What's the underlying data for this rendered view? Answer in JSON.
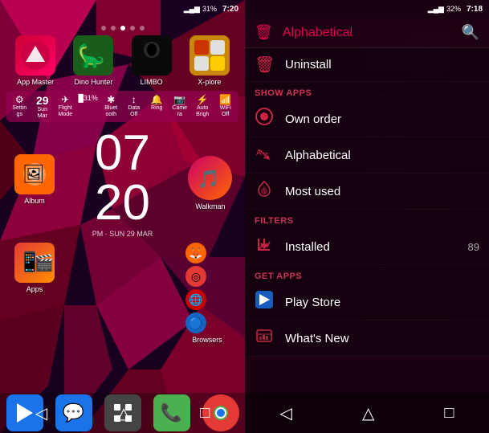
{
  "left": {
    "status": {
      "signal": "▂▄▆",
      "battery": "31%",
      "time": "7:20"
    },
    "dots": [
      false,
      false,
      true,
      false,
      false
    ],
    "apps_row1": [
      {
        "label": "App Master",
        "color": "#cc0033",
        "text": "⊕"
      },
      {
        "label": "Dino Hunter",
        "color": "#2d6e2d",
        "text": "🦎"
      },
      {
        "label": "LIMBO",
        "color": "#111",
        "text": "👤"
      },
      {
        "label": "X-plore",
        "color": "#DAA520",
        "text": "🗂"
      }
    ],
    "quick_settings": [
      {
        "icon": "⚙",
        "label": "Settin\ngs"
      },
      {
        "icon": "29",
        "label": "Sun\nMar"
      },
      {
        "icon": "✈",
        "label": "Flight\nMode"
      },
      {
        "icon": "31%",
        "label": ""
      },
      {
        "icon": "✱",
        "label": "Bluet\nooth"
      },
      {
        "icon": "↕",
        "label": "Data\nOff"
      },
      {
        "icon": "🔔",
        "label": "Ring"
      },
      {
        "icon": "📷",
        "label": "Came\nra"
      },
      {
        "icon": "⚡",
        "label": "Auto\nBrigh"
      },
      {
        "icon": "📶",
        "label": "WiFi\nOff"
      }
    ],
    "clock": {
      "hour": "07",
      "min": "20",
      "date": "PM · SUN 29 MAR"
    },
    "walkman_label": "Walkman",
    "browsers_label": "Browsers",
    "dock": [
      {
        "label": "Play Store",
        "color": "#1a73e8",
        "icon": "▶"
      },
      {
        "label": "Messages",
        "color": "#1a73e8",
        "icon": "💬"
      },
      {
        "label": "Apps",
        "color": "#555",
        "icon": "⋮⋮"
      },
      {
        "label": "Phone",
        "color": "#4CAF50",
        "icon": "📞"
      },
      {
        "label": "Chrome",
        "color": "#e53935",
        "icon": "◎"
      }
    ],
    "nav": [
      "◁",
      "△",
      "□"
    ]
  },
  "right": {
    "status": {
      "signal": "▂▄▆",
      "battery": "32%",
      "time": "7:18"
    },
    "top_bar": {
      "title": "Alphabetical",
      "trash_icon": "🗑",
      "search_icon": "🔍"
    },
    "uninstall_label": "Uninstall",
    "sections": [
      {
        "label": "SHOW APPS",
        "items": [
          {
            "icon": "person_circle",
            "text": "Own order",
            "badge": ""
          },
          {
            "icon": "sort_alpha",
            "text": "Alphabetical",
            "badge": ""
          },
          {
            "icon": "heart",
            "text": "Most used",
            "badge": ""
          }
        ]
      },
      {
        "label": "FILTERS",
        "items": [
          {
            "icon": "download",
            "text": "Installed",
            "badge": "89"
          }
        ]
      },
      {
        "label": "GET APPS",
        "items": [
          {
            "icon": "play_store",
            "text": "Play Store",
            "badge": ""
          },
          {
            "icon": "whats_new",
            "text": "What's New",
            "badge": ""
          }
        ]
      }
    ],
    "nav": [
      "◁",
      "△",
      "□"
    ]
  }
}
